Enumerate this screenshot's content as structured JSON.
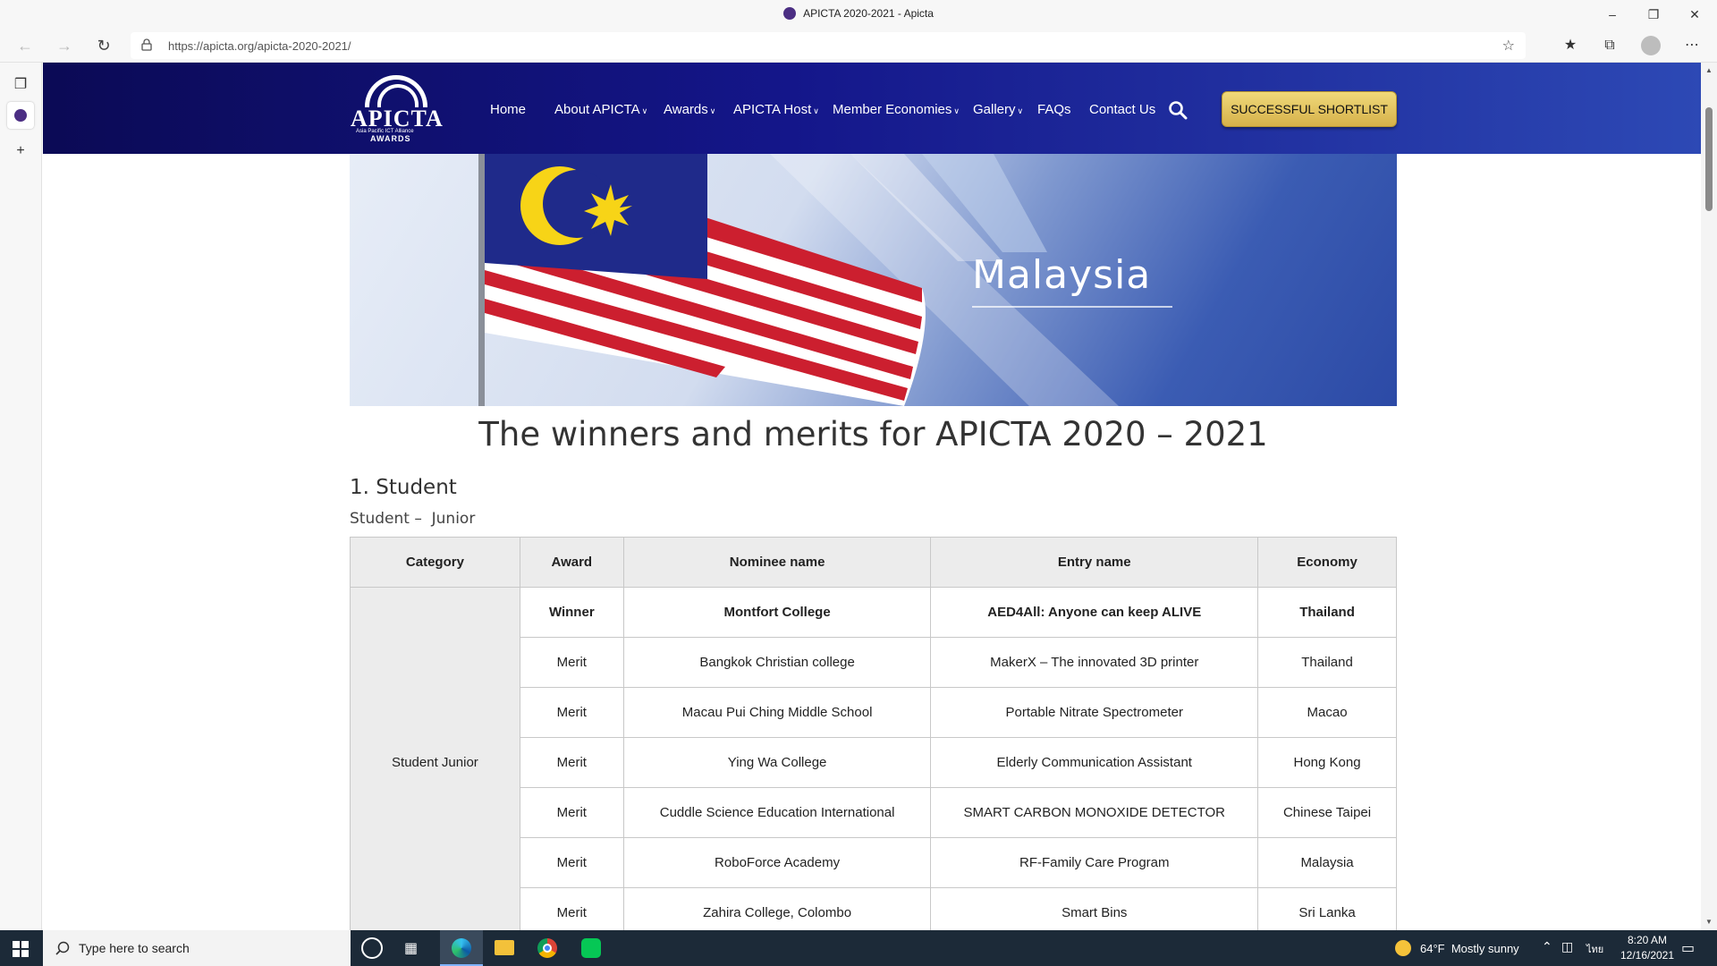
{
  "window": {
    "title": "APICTA 2020-2021 - Apicta",
    "minimize": "–",
    "maximize": "❐",
    "close": "✕"
  },
  "toolbar": {
    "url": "https://apicta.org/apicta-2020-2021/",
    "icons": [
      "back-icon",
      "forward-icon",
      "refresh-icon",
      "lock-icon",
      "add-favorite-icon",
      "favorites-icon",
      "collections-icon",
      "profile-icon",
      "more-icon"
    ]
  },
  "site": {
    "logo": {
      "name": "APICTA",
      "tagline": "Asia Pacific ICT Alliance",
      "awards": "AWARDS"
    },
    "nav": [
      {
        "label": "Home",
        "dropdown": false
      },
      {
        "label": "About APICTA",
        "dropdown": true
      },
      {
        "label": "Awards",
        "dropdown": true
      },
      {
        "label": "APICTA Host",
        "dropdown": true
      },
      {
        "label": "Member Economies",
        "dropdown": true
      },
      {
        "label": "Gallery",
        "dropdown": true
      },
      {
        "label": "FAQs",
        "dropdown": false
      },
      {
        "label": "Contact Us",
        "dropdown": false
      }
    ],
    "shortlist_label": "SUCCESSFUL SHORTLIST",
    "colors": {
      "header_dark": "#0b0a55",
      "header_light": "#2d49b5",
      "button_gold": "#e2c462"
    }
  },
  "banner": {
    "country": "Malaysia"
  },
  "page": {
    "title": "The winners and merits for APICTA 2020 – 2021",
    "section": "1. Student",
    "subsection": "Student –  Junior"
  },
  "table": {
    "headers": [
      "Category",
      "Award",
      "Nominee name",
      "Entry name",
      "Economy"
    ],
    "category": "Student Junior",
    "rows": [
      {
        "award": "Winner",
        "nominee": "Montfort College",
        "entry": "AED4All: Anyone can keep ALIVE",
        "economy": "Thailand"
      },
      {
        "award": "Merit",
        "nominee": "Bangkok Christian college",
        "entry": "MakerX – The innovated 3D printer",
        "economy": "Thailand"
      },
      {
        "award": "Merit",
        "nominee": "Macau Pui Ching Middle School",
        "entry": "Portable Nitrate Spectrometer",
        "economy": "Macao"
      },
      {
        "award": "Merit",
        "nominee": "Ying Wa College",
        "entry": "Elderly Communication Assistant",
        "economy": "Hong Kong"
      },
      {
        "award": "Merit",
        "nominee": "Cuddle Science Education International",
        "entry": "SMART CARBON MONOXIDE DETECTOR",
        "economy": "Chinese Taipei"
      },
      {
        "award": "Merit",
        "nominee": "RoboForce Academy",
        "entry": "RF-Family Care Program",
        "economy": "Malaysia"
      },
      {
        "award": "Merit",
        "nominee": "Zahira College, Colombo",
        "entry": "Smart Bins",
        "economy": "Sri Lanka"
      }
    ]
  },
  "taskbar": {
    "search_placeholder": "Type here to search",
    "weather": "64°F  Mostly sunny",
    "lang": "ไทย",
    "time": "8:20 AM",
    "date": "12/16/2021"
  }
}
